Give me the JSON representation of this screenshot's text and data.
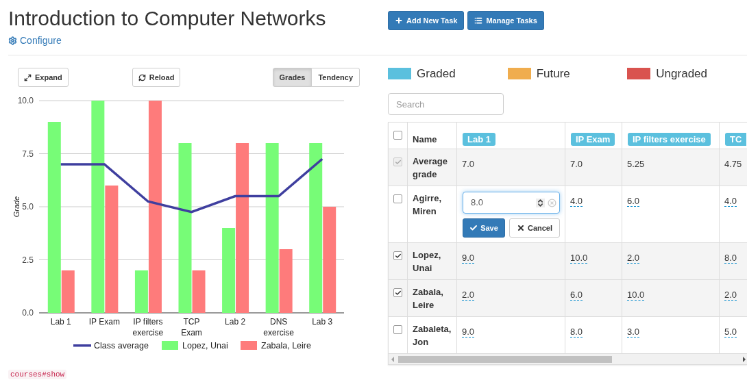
{
  "title": "Introduction to Computer Networks",
  "configure_link": "Configure",
  "header_buttons": [
    "Add New Task",
    "Manage Tasks"
  ],
  "chart_toolbar": {
    "expand": "Expand",
    "reload": "Reload",
    "modes": [
      {
        "label": "Grades",
        "selected": true
      },
      {
        "label": "Tendency",
        "selected": false
      }
    ]
  },
  "chart": {
    "chart_data": {
      "type": "bar",
      "ylabel": "Grade",
      "categories": [
        "Lab 1",
        "IP Exam",
        "IP filters exercise",
        "TCP Exam",
        "Lab 2",
        "DNS exercise",
        "Lab 3"
      ],
      "ylim": [
        0,
        10
      ],
      "grid": true,
      "legend": "bottom",
      "yticks": [
        {
          "value": 0,
          "label": "0.0"
        },
        {
          "value": 2.5,
          "label": "2.5"
        },
        {
          "value": 5,
          "label": "5.0"
        },
        {
          "value": 7.5,
          "label": "7.5"
        },
        {
          "value": 10,
          "label": "10.0"
        }
      ],
      "series": [
        {
          "name": "Class average",
          "color": "#3f3f9f",
          "type": "line",
          "values": [
            7,
            7,
            5.25,
            4.75,
            5.5,
            5.5,
            7.25
          ]
        },
        {
          "name": "Lopez, Unai",
          "color": "#77fc77",
          "values": [
            9,
            10,
            2,
            8,
            4,
            8,
            8
          ]
        },
        {
          "name": "Zabala, Leire",
          "color": "#fe7b7b",
          "values": [
            2,
            6,
            10,
            2,
            8,
            3,
            5
          ]
        }
      ]
    }
  },
  "legend": [
    {
      "label": "Graded",
      "color": "#5bc0de"
    },
    {
      "label": "Future",
      "color": "#f0ad4e"
    },
    {
      "label": "Ungraded",
      "color": "#d9534f"
    }
  ],
  "search": {
    "placeholder": "Search"
  },
  "table": {
    "select_all_checked": false,
    "name_header": "Name",
    "columns": [
      "Lab 1",
      "IP Exam",
      "IP filters exercise",
      "TC"
    ],
    "rows": [
      {
        "name": "Average grade",
        "checked": true,
        "disabled": true,
        "cells": [
          {
            "kind": "average",
            "value": "7.0"
          },
          {
            "kind": "average",
            "value": "7.0"
          },
          {
            "kind": "average",
            "value": "5.25"
          },
          {
            "kind": "average",
            "value": "4.75"
          }
        ]
      },
      {
        "name": "Agirre, Miren",
        "checked": false,
        "disabled": false,
        "cells": [
          {
            "kind": "editor",
            "value": "8.0",
            "save": "Save",
            "cancel": "Cancel"
          },
          {
            "kind": "grade",
            "value": "4.0"
          },
          {
            "kind": "grade",
            "value": "6.0"
          },
          {
            "kind": "grade",
            "value": "4.0"
          }
        ]
      },
      {
        "name": "Lopez, Unai",
        "checked": true,
        "disabled": false,
        "cells": [
          {
            "kind": "grade",
            "value": "9.0"
          },
          {
            "kind": "grade",
            "value": "10.0"
          },
          {
            "kind": "grade",
            "value": "2.0"
          },
          {
            "kind": "grade",
            "value": "8.0"
          }
        ]
      },
      {
        "name": "Zabala, Leire",
        "checked": true,
        "disabled": false,
        "cells": [
          {
            "kind": "grade",
            "value": "2.0"
          },
          {
            "kind": "grade",
            "value": "6.0"
          },
          {
            "kind": "grade",
            "value": "10.0"
          },
          {
            "kind": "grade",
            "value": "2.0"
          }
        ]
      },
      {
        "name": "Zabaleta, Jon",
        "checked": false,
        "disabled": false,
        "cells": [
          {
            "kind": "grade",
            "value": "9.0"
          },
          {
            "kind": "grade",
            "value": "8.0"
          },
          {
            "kind": "grade",
            "value": "3.0"
          },
          {
            "kind": "grade",
            "value": "5.0"
          }
        ]
      }
    ]
  },
  "route_label": "courses#show"
}
